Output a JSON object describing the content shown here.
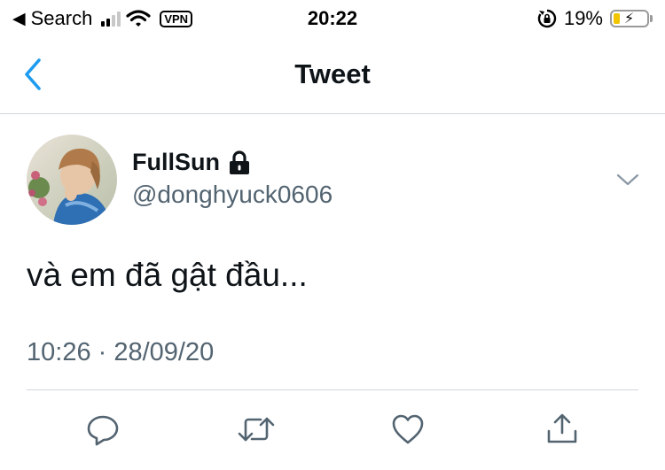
{
  "status_bar": {
    "back_app": "Search",
    "vpn": "VPN",
    "time": "20:22",
    "battery_percent": "19%",
    "battery_level": 0.19,
    "battery_color": "#f2c500"
  },
  "nav": {
    "title": "Tweet",
    "accent": "#1d9bf0"
  },
  "tweet": {
    "display_name": "FullSun",
    "handle": "@donghyuck0606",
    "text": "và em đã gật đầu...",
    "timestamp": "10:26 · 28/09/20",
    "protected": true
  },
  "icons": {
    "back": "chevron-left-icon",
    "lock": "lock-icon",
    "more": "chevron-down-icon",
    "reply": "reply-icon",
    "retweet": "retweet-icon",
    "like": "heart-icon",
    "share": "share-icon"
  }
}
